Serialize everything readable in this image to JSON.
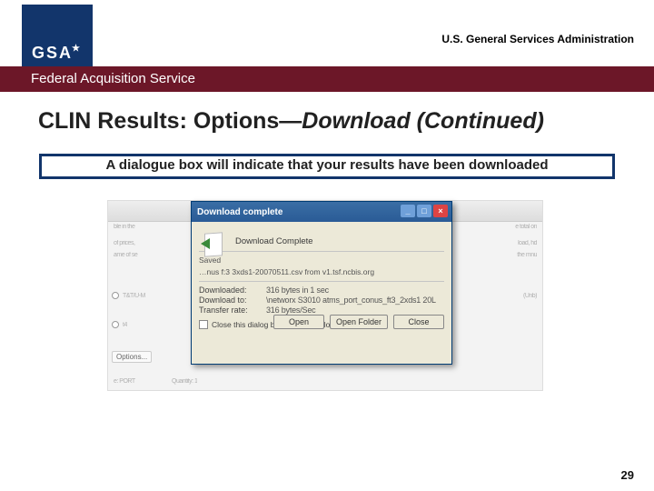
{
  "logo": {
    "text": "GSA"
  },
  "header_right": "U.S. General Services Administration",
  "maroon_bar": "Federal Acquisition Service",
  "title_main": "CLIN Results:  Options—",
  "title_em": "Download (Continued)",
  "body_line": "A dialogue box will indicate that your results have been downloaded",
  "bg": {
    "row0a": "ble in the",
    "row0b": "e total on",
    "row1a": "of prices,",
    "row1b": "load, hd",
    "row2a": "ame of se",
    "row2b": "the mnu",
    "row3": "T&T/U-M",
    "row3b": "(Unb)",
    "row4": "t4",
    "options": "Options...",
    "port": "e: PORT",
    "qty": "Quantity: 1"
  },
  "dialog": {
    "title": "Download complete",
    "heading": "Download Complete",
    "saved_label": "Saved",
    "saved_value": "…nus f:3 3xds1-20070511.csv from v1.tsf.ncbis.org",
    "rows": [
      {
        "k": "Downloaded:",
        "v": "316 bytes in 1 sec"
      },
      {
        "k": "Download to:",
        "v": "\\networx S3010 atms_port_conus_ft3_2xds1 20L"
      },
      {
        "k": "Transfer rate:",
        "v": "316 bytes/Sec"
      }
    ],
    "checkbox": "Close this dialog box when download completes",
    "buttons": {
      "open": "Open",
      "folder": "Open Folder",
      "close": "Close"
    }
  },
  "page_number": "29"
}
